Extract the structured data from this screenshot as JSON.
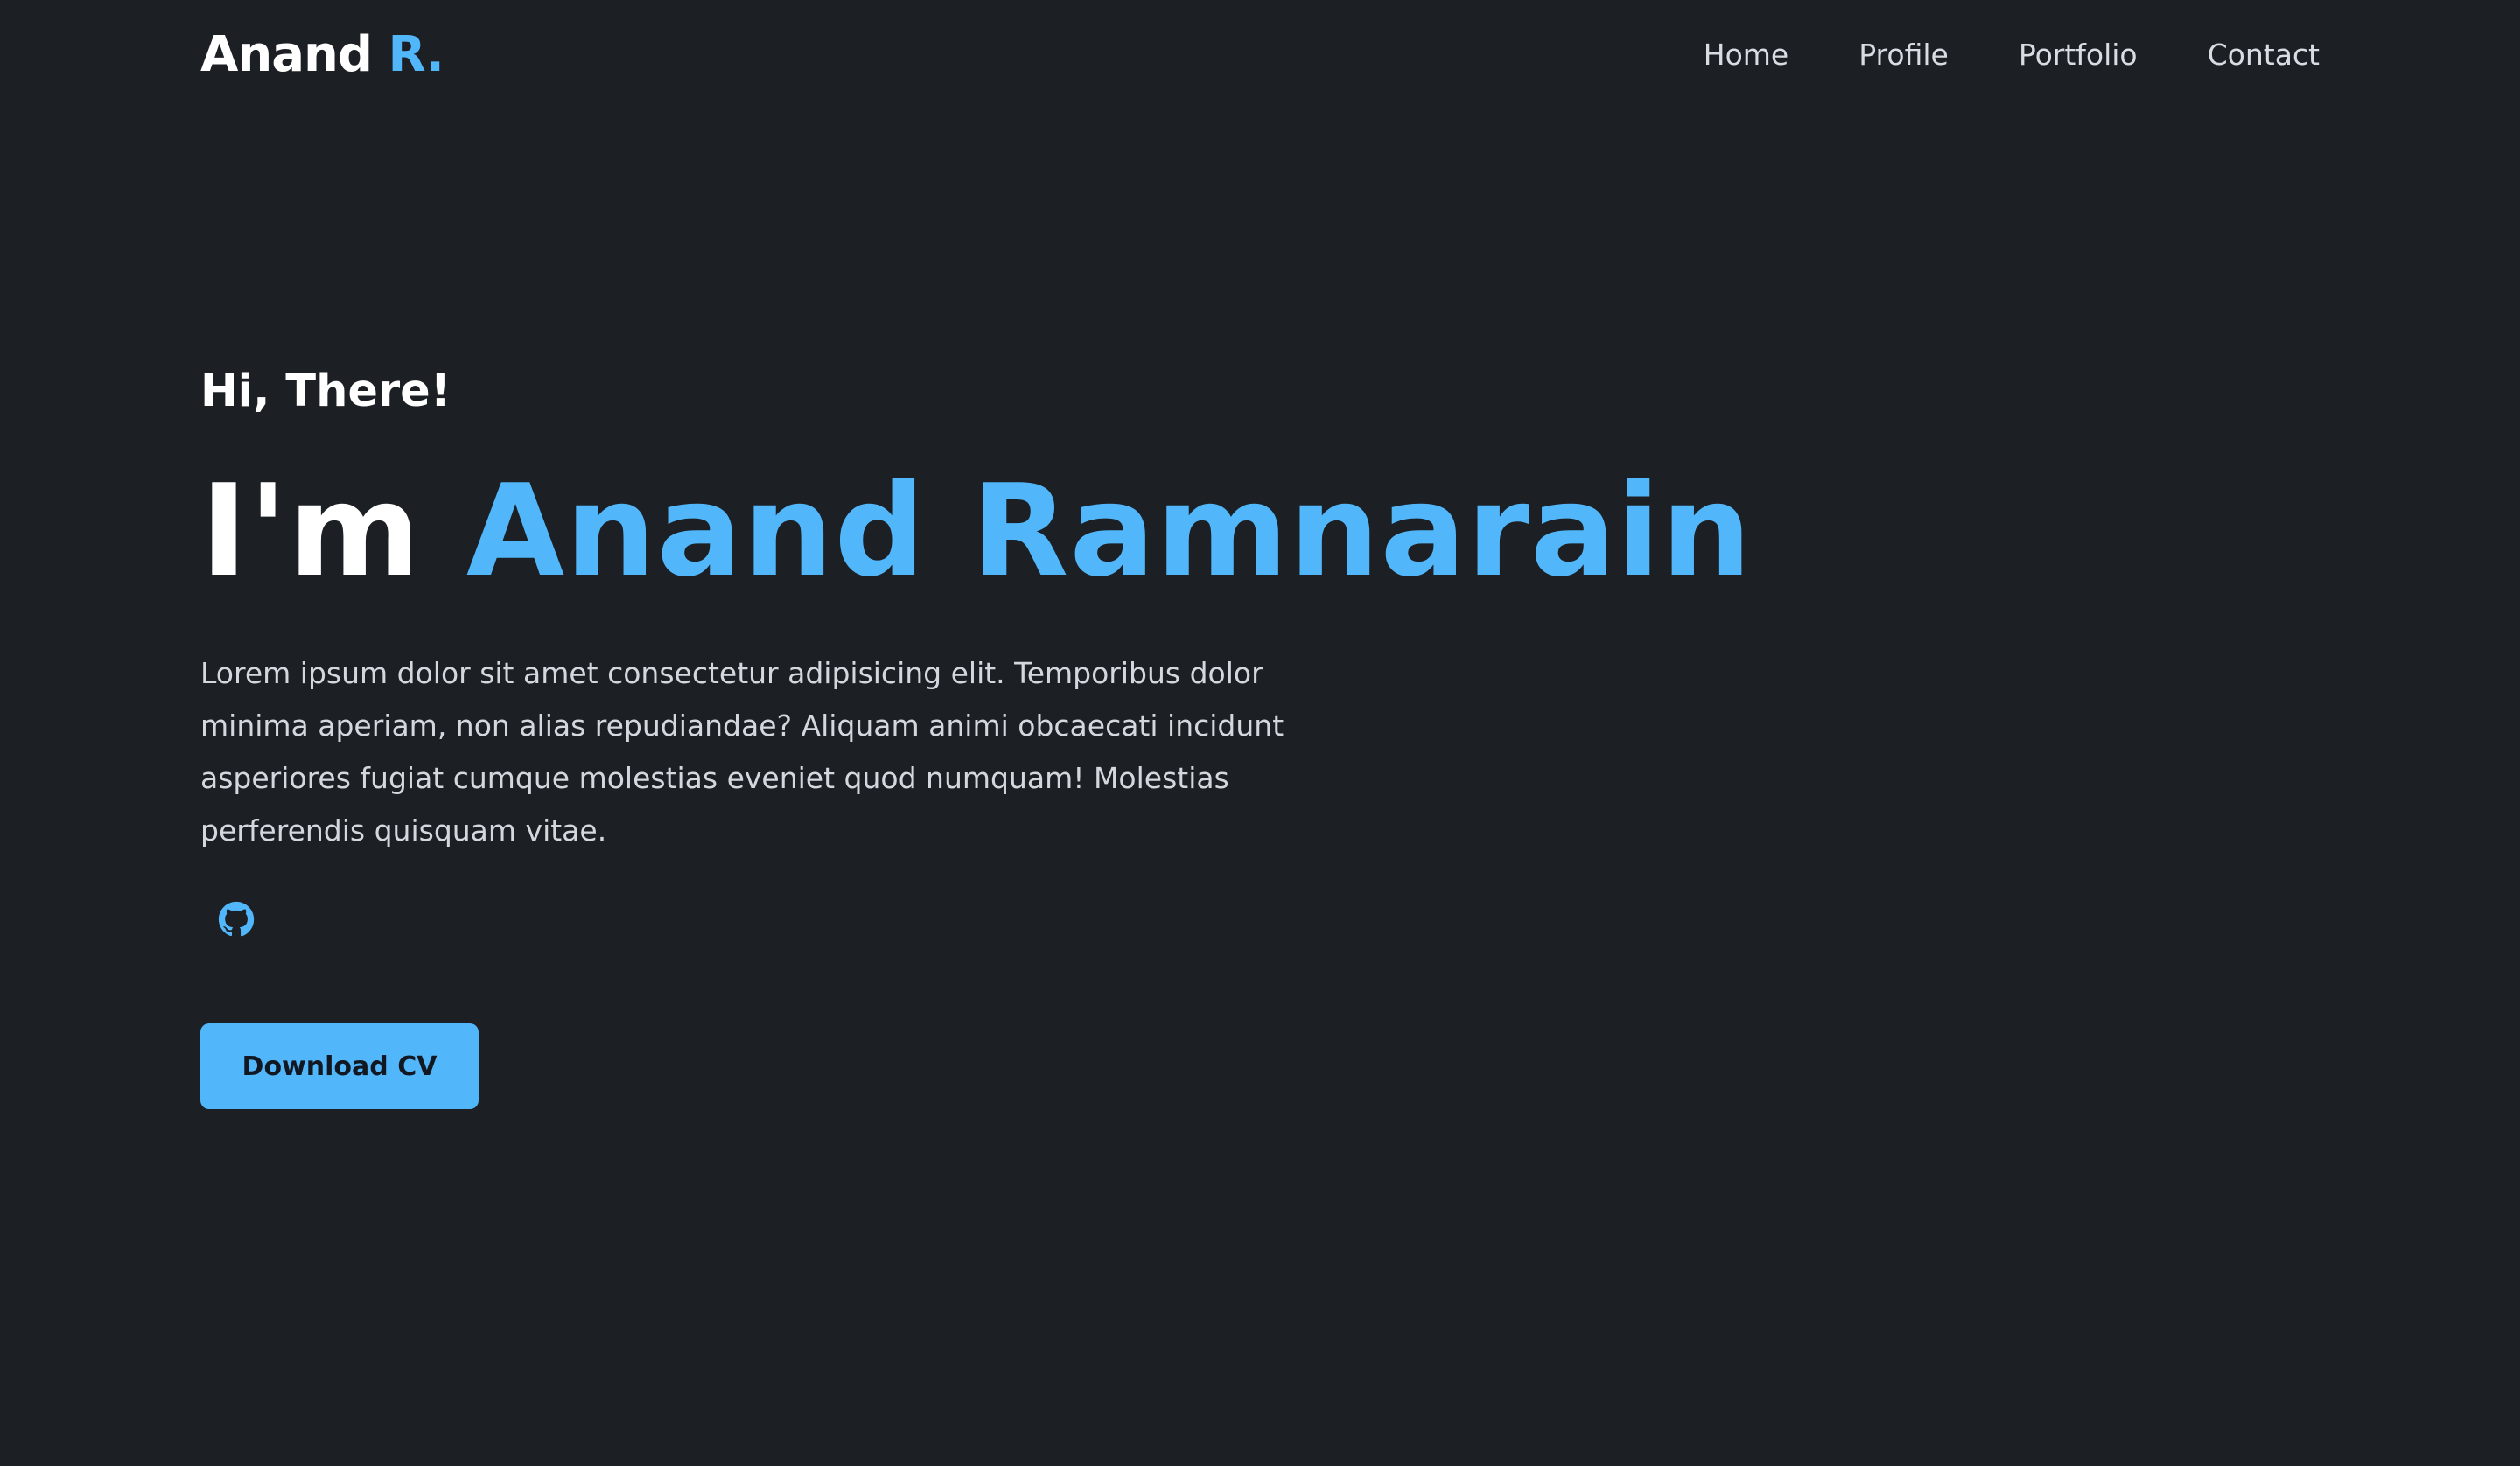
{
  "header": {
    "logo_main": "Anand",
    "logo_accent": "R.",
    "nav": [
      "Home",
      "Profile",
      "Portfolio",
      "Contact"
    ]
  },
  "hero": {
    "greeting": "Hi, There!",
    "headline_prefix": "I'm",
    "headline_name": "Anand Ramnarain",
    "bio": "Lorem ipsum dolor sit amet consectetur adipisicing elit. Temporibus dolor minima aperiam, non alias repudiandae? Aliquam animi obcaecati incidunt asperiores fugiat cumque molestias eveniet quod numquam! Molestias perferendis quisquam vitae.",
    "social_icon": "github-icon",
    "cta_label": "Download CV"
  },
  "colors": {
    "background": "#1c1f24",
    "accent": "#51b7fa",
    "text": "#ffffff",
    "muted_text": "#d3d8df"
  }
}
